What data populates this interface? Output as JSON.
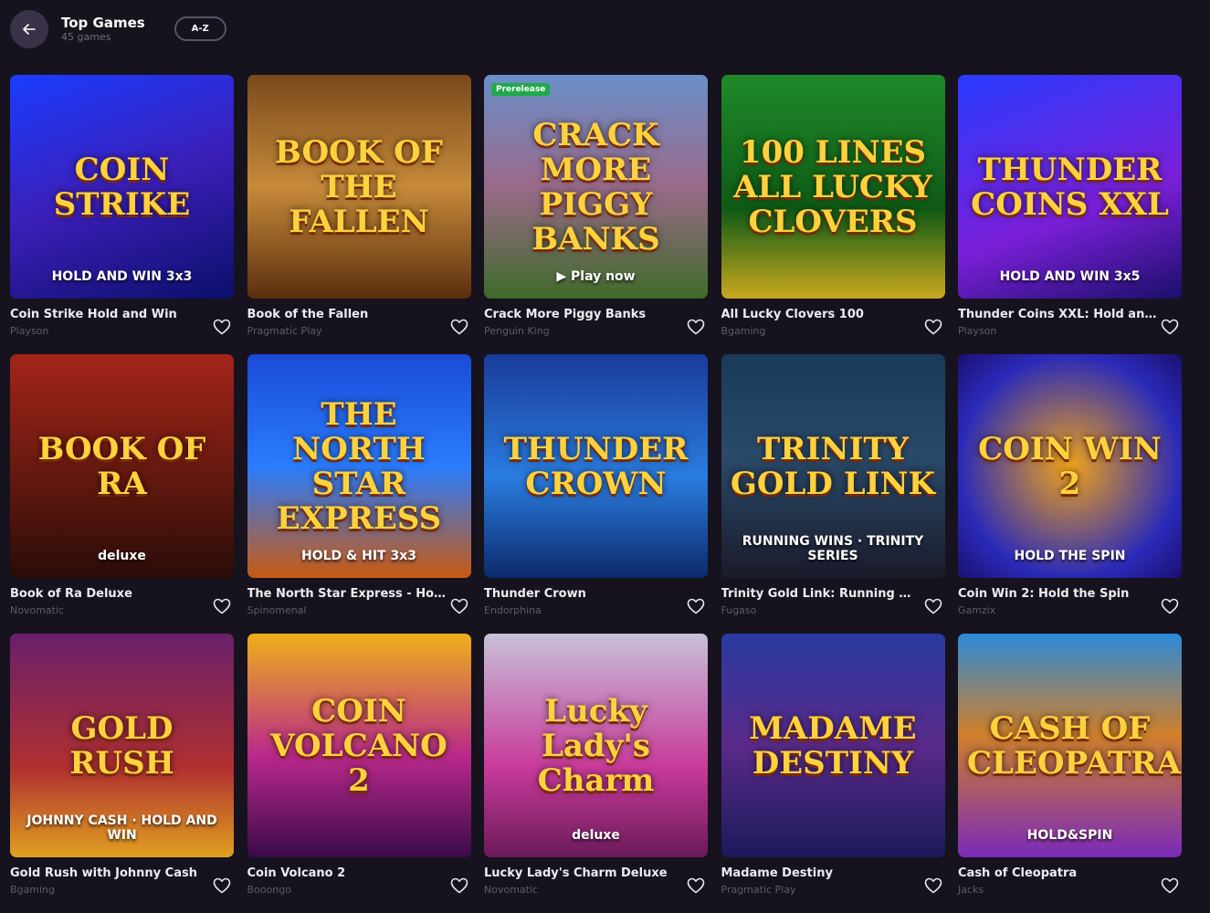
{
  "header": {
    "title": "Top Games",
    "subtitle": "45 games",
    "sort_label": "A-Z"
  },
  "games": [
    {
      "name": "Coin Strike Hold and Win",
      "provider": "Playson",
      "art": "COIN STRIKE",
      "art_sub": "HOLD AND WIN 3x3",
      "bg": "linear-gradient(160deg,#1a3cff 0%,#3b1fb8 50%,#0b0f6b 100%)",
      "badge": ""
    },
    {
      "name": "Book of the Fallen",
      "provider": "Pragmatic Play",
      "art": "BOOK OF THE FALLEN",
      "art_sub": "",
      "bg": "linear-gradient(180deg,#7a4a1c 0%,#c78a3a 50%,#5c2e0e 100%)",
      "badge": ""
    },
    {
      "name": "Crack More Piggy Banks",
      "provider": "Penguin King",
      "art": "CRACK MORE PIGGY BANKS",
      "art_sub": "▶ Play now",
      "bg": "linear-gradient(180deg,#6a8fc9 0%,#9a6a8a 50%,#3f6b2a 100%)",
      "badge": "Prerelease"
    },
    {
      "name": "All Lucky Clovers 100",
      "provider": "Bgaming",
      "art": "100 LINES ALL LUCKY CLOVERS",
      "art_sub": "",
      "bg": "linear-gradient(180deg,#1f8a2a 0%,#0f5a16 60%,#c9a81e 100%)",
      "badge": ""
    },
    {
      "name": "Thunder Coins XXL: Hold and Win",
      "provider": "Playson",
      "art": "THUNDER COINS XXL",
      "art_sub": "HOLD AND WIN 3x5",
      "bg": "linear-gradient(160deg,#2a3cff 0%,#7a1fd8 60%,#1b0f6b 100%)",
      "badge": ""
    },
    {
      "name": "Book of Ra Deluxe",
      "provider": "Novomatic",
      "art": "BOOK OF RA",
      "art_sub": "deluxe",
      "bg": "linear-gradient(180deg,#a3241a 0%,#6a1a10 50%,#2a0c08 100%)",
      "badge": ""
    },
    {
      "name": "The North Star Express - Hold & Hit",
      "provider": "Spinomenal",
      "art": "THE NORTH STAR EXPRESS",
      "art_sub": "HOLD & HIT 3x3",
      "bg": "linear-gradient(180deg,#1a4bd8 0%,#2a7cff 50%,#c85a12 100%)",
      "badge": ""
    },
    {
      "name": "Thunder Crown",
      "provider": "Endorphina",
      "art": "THUNDER CROWN",
      "art_sub": "",
      "bg": "linear-gradient(180deg,#1a3c9a 0%,#2a7ce0 55%,#0b2a6b 100%)",
      "badge": ""
    },
    {
      "name": "Trinity Gold Link: Running Wins",
      "provider": "Fugaso",
      "art": "TRINITY GOLD LINK",
      "art_sub": "RUNNING WINS · TRINITY SERIES",
      "bg": "linear-gradient(180deg,#1a3a5a 0%,#2a4a6a 45%,#1a1a2a 100%)",
      "badge": ""
    },
    {
      "name": "Coin Win 2: Hold the Spin",
      "provider": "Gamzix",
      "art": "COIN WIN 2",
      "art_sub": "HOLD THE SPIN",
      "bg": "radial-gradient(circle at 50% 50%,#f0a21a 0%,#2a2ab8 70%,#1b1070 100%)",
      "badge": ""
    },
    {
      "name": "Gold Rush with Johnny Cash",
      "provider": "Bgaming",
      "art": "GOLD RUSH",
      "art_sub": "JOHNNY CASH · HOLD AND WIN",
      "bg": "linear-gradient(180deg,#6a1f6a 0%,#b03030 60%,#e0a020 100%)",
      "badge": ""
    },
    {
      "name": "Coin Volcano 2",
      "provider": "Booongo",
      "art": "COIN VOLCANO 2",
      "art_sub": "",
      "bg": "linear-gradient(180deg,#f0b01a 0%,#b8288a 55%,#3a0a4a 100%)",
      "badge": ""
    },
    {
      "name": "Lucky Lady's Charm Deluxe",
      "provider": "Novomatic",
      "art": "Lucky Lady's Charm",
      "art_sub": "deluxe",
      "bg": "linear-gradient(180deg,#c8c0d8 0%,#c83a9a 60%,#6a1a5a 100%)",
      "badge": ""
    },
    {
      "name": "Madame Destiny",
      "provider": "Pragmatic Play",
      "art": "MADAME DESTINY",
      "art_sub": "",
      "bg": "linear-gradient(180deg,#2a3aa0 0%,#5a2a8a 50%,#1a1a5a 100%)",
      "badge": ""
    },
    {
      "name": "Cash of Cleopatra",
      "provider": "Jacks",
      "art": "CASH OF CLEOPATRA",
      "art_sub": "HOLD&SPIN",
      "bg": "linear-gradient(180deg,#2a8ad8 0%,#d0802a 45%,#7a2ab8 100%)",
      "badge": ""
    }
  ]
}
